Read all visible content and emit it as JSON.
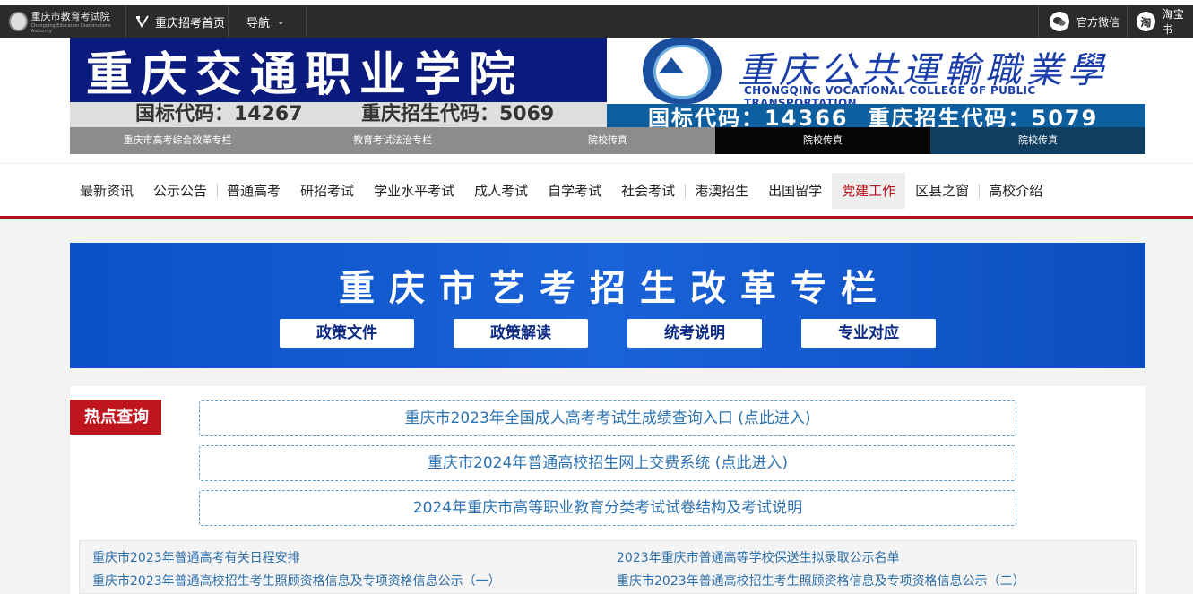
{
  "topbar": {
    "logo_text": "重庆市教育考试院",
    "logo_sub": "Chongqing Education Examinations Authority",
    "home_label": "重庆招考首页",
    "nav_label": "导航",
    "wechat_label": "官方微信",
    "taobao_icon_text": "淘",
    "taobao_label": "淘宝书"
  },
  "banner": {
    "left_title": "重庆交通职业学院",
    "left_code_intl": "国标代码：14267",
    "left_code_cq": "重庆招生代码：5069",
    "right_title_cn": "重庆公共運輸職業學院",
    "right_title_en": "CHONGQING VOCATIONAL COLLEGE OF PUBLIC TRANSPORTATION",
    "right_code_intl": "国标代码：14366",
    "right_code_cq": "重庆招生代码：5079"
  },
  "subnav": [
    "重庆市高考综合改革专栏",
    "教育考试法治专栏",
    "院校传真",
    "院校传真",
    "院校传真"
  ],
  "mainnav": [
    {
      "label": "最新资讯"
    },
    {
      "label": "公示公告"
    },
    {
      "label": "普通高考"
    },
    {
      "label": "研招考试"
    },
    {
      "label": "学业水平考试"
    },
    {
      "label": "成人考试"
    },
    {
      "label": "自学考试"
    },
    {
      "label": "社会考试"
    },
    {
      "label": "港澳招生"
    },
    {
      "label": "出国留学"
    },
    {
      "label": "党建工作"
    },
    {
      "label": "区县之窗"
    },
    {
      "label": "高校介绍"
    }
  ],
  "art_banner": {
    "title": "重庆市艺考招生改革专栏",
    "buttons": [
      "政策文件",
      "政策解读",
      "统考说明",
      "专业对应"
    ]
  },
  "hot": {
    "tag": "热点查询",
    "links": [
      "重庆市2023年全国成人高考考试生成绩查询入口 (点此进入)",
      "重庆市2024年普通高校招生网上交费系统 (点此进入)",
      "2024年重庆市高等职业教育分类考试试卷结构及考试说明"
    ]
  },
  "news": [
    "重庆市2023年普通高考有关日程安排",
    "2023年重庆市普通高等学校保送生拟录取公示名单",
    "重庆市2023年普通高校招生考生照顾资格信息及专项资格信息公示（一）",
    "重庆市2023年普通高校招生考生照顾资格信息及专项资格信息公示（二）"
  ],
  "colors": {
    "accent_red": "#b3121b",
    "banner_blue": "#0b50c6",
    "link_blue": "#2c72b0"
  }
}
